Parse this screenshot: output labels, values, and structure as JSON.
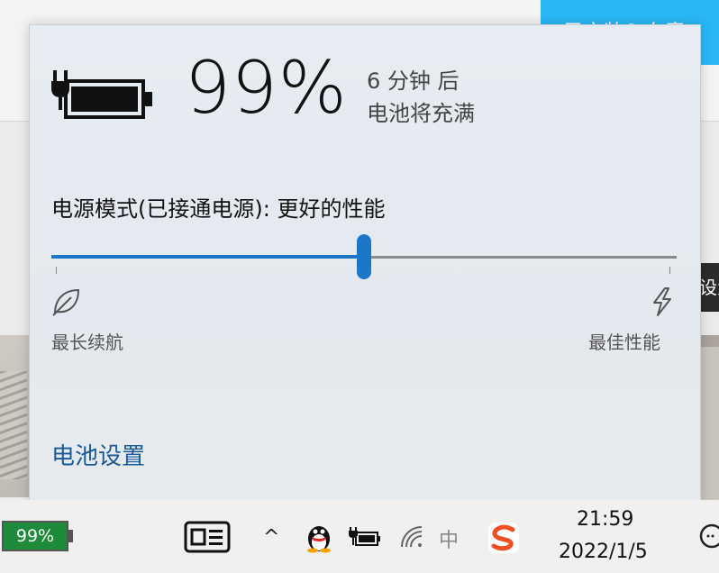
{
  "background": {
    "top_button_text": "已安装Q 有责",
    "side_tab_text": "设置"
  },
  "flyout": {
    "percent": "99%",
    "time_remaining_line1": "6 分钟 后",
    "time_remaining_line2": "电池将充满",
    "power_mode_label": "电源模式(已接通电源): 更好的性能",
    "slider_position": 0.5,
    "slider_left_label": "最长续航",
    "slider_right_label": "最佳性能",
    "settings_link": "电池设置",
    "icons": {
      "battery": "battery-charging-icon",
      "leaf": "leaf-icon",
      "bolt": "lightning-bolt-icon"
    }
  },
  "taskbar": {
    "battery_percent": "99%",
    "show_hidden_icons": "^",
    "ime_text": "中",
    "time": "21:59",
    "date": "2022/1/5",
    "icons": [
      "news-icon",
      "qq-icon",
      "power-plug-icon",
      "wifi-icon",
      "sogou-icon",
      "notification-icon"
    ]
  },
  "colors": {
    "accent": "#1c77c9",
    "link": "#1a5a96",
    "battery_green": "#1e8b3a",
    "cyan": "#29b7f5"
  }
}
